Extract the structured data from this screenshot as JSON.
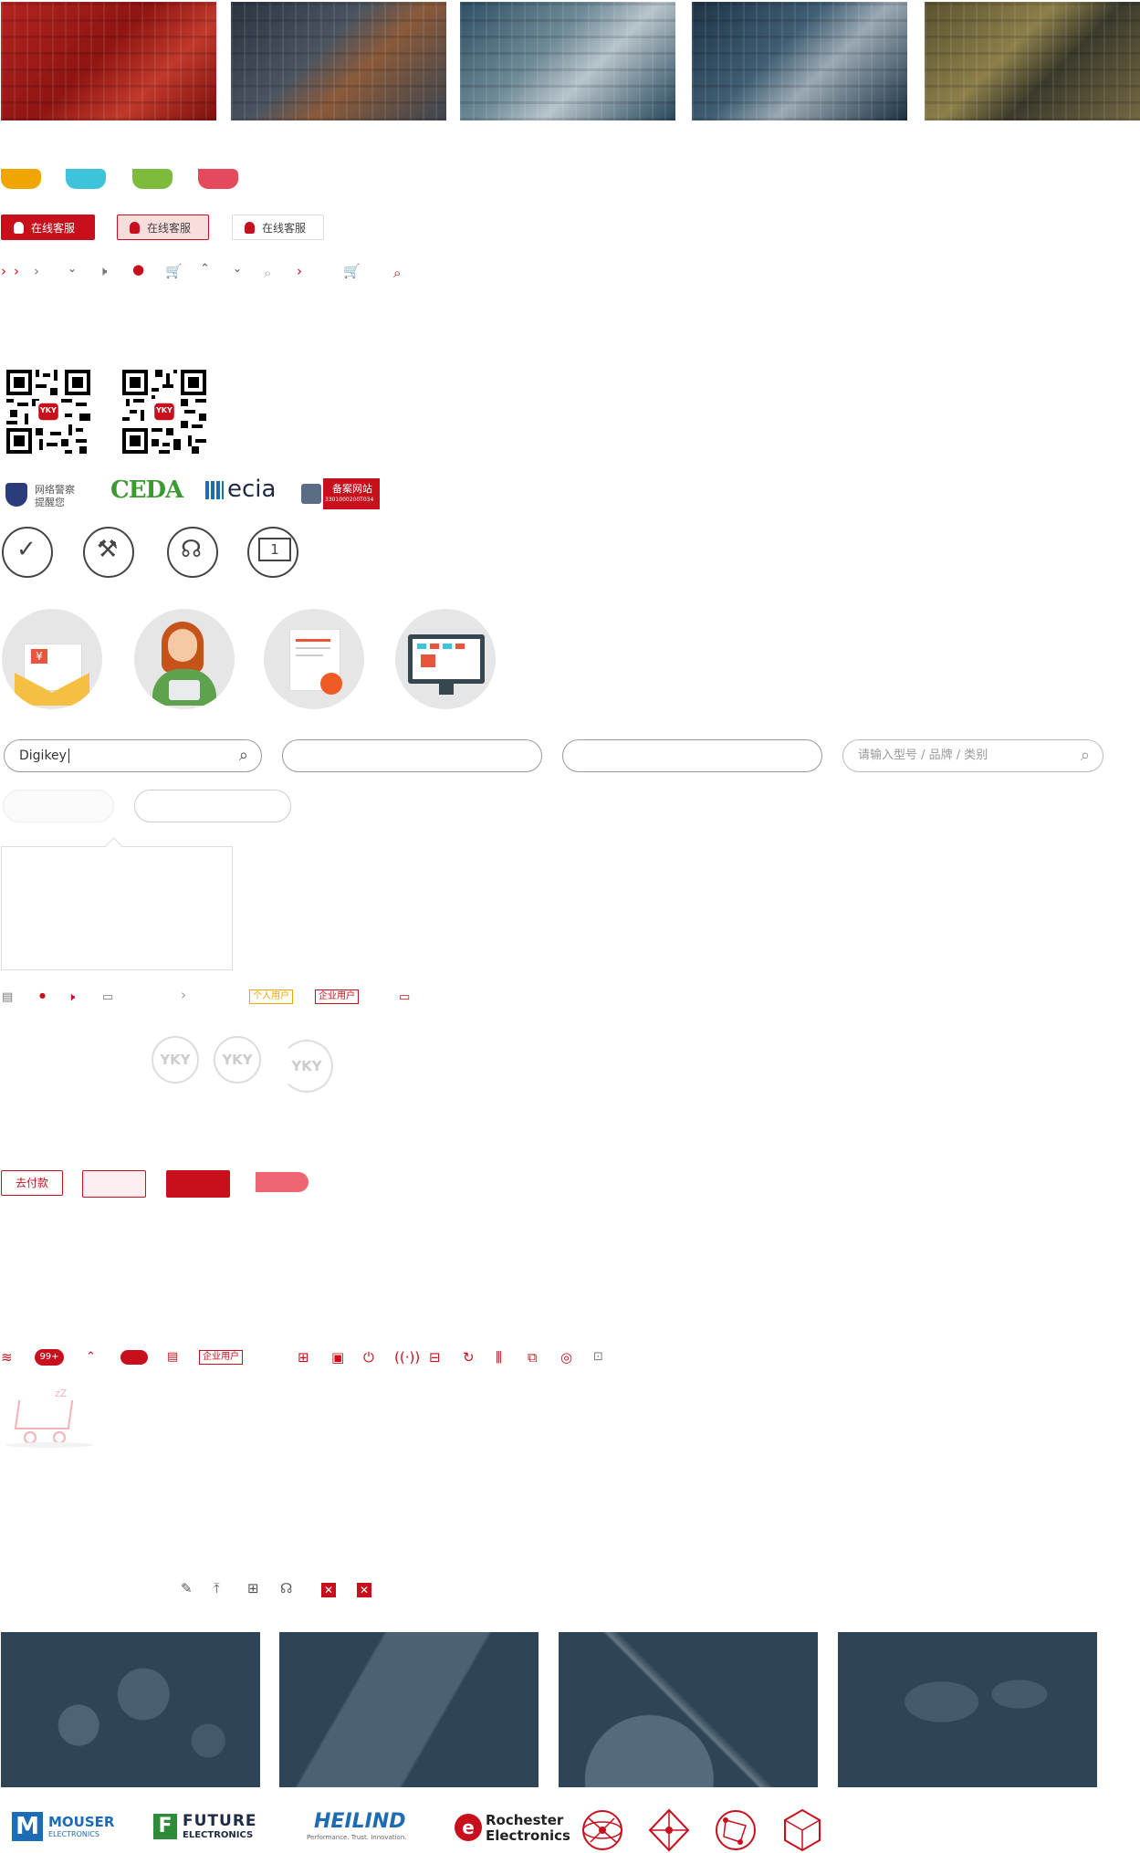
{
  "colors": {
    "brand_red": "#c8101d",
    "orange": "#f0a500",
    "cyan": "#3ec3dc",
    "green": "#7cbb3b",
    "coral": "#e34b5c",
    "gray_border": "#999999",
    "panel_navy": "#2d4557"
  },
  "banners": [
    {
      "icon": "red-envelope-banner"
    },
    {
      "icon": "multimeter-banner"
    },
    {
      "icon": "motherboard-banner"
    },
    {
      "icon": "cpu-socket-banner"
    },
    {
      "icon": "circuit-board-banner"
    }
  ],
  "flags": [
    {
      "color": "#f0a500"
    },
    {
      "color": "#3ec3dc"
    },
    {
      "color": "#7cbb3b"
    },
    {
      "color": "#e34b5c"
    }
  ],
  "service_buttons": [
    "在线客服",
    "在线客服",
    "在线客服"
  ],
  "qr_logo": "YKY",
  "badges": {
    "police_line1": "网络警察",
    "police_line2": "提醒您",
    "ceda": "CEDA",
    "ecia": "ecia",
    "record_title": "备案网站",
    "record_number": "3301000200T034"
  },
  "search": {
    "value": "Digikey",
    "placeholder": "请输入型号 / 品牌 / 类别"
  },
  "tags": {
    "personal_user": "个人用户",
    "enterprise_user": "企业用户",
    "enterprise_user_2": "企业用户"
  },
  "yky_logos": [
    "YKY",
    "YKY",
    "YKY"
  ],
  "pay_button": "去付款",
  "notification_count": "99+",
  "panels": [
    {
      "icon": "currency-panel"
    },
    {
      "icon": "phone-panel"
    },
    {
      "icon": "globe-panel"
    },
    {
      "icon": "world-map-panel"
    }
  ],
  "brands": {
    "mouser_1": "MOUSER",
    "mouser_2": "ELECTRONICS",
    "future_1": "FUTURE",
    "future_2": "ELECTRONICS",
    "heilind": "HEILIND",
    "heilind_tag": "Performance. Trust. Innovation.",
    "rochester_1": "Rochester",
    "rochester_2": "Electronics"
  }
}
